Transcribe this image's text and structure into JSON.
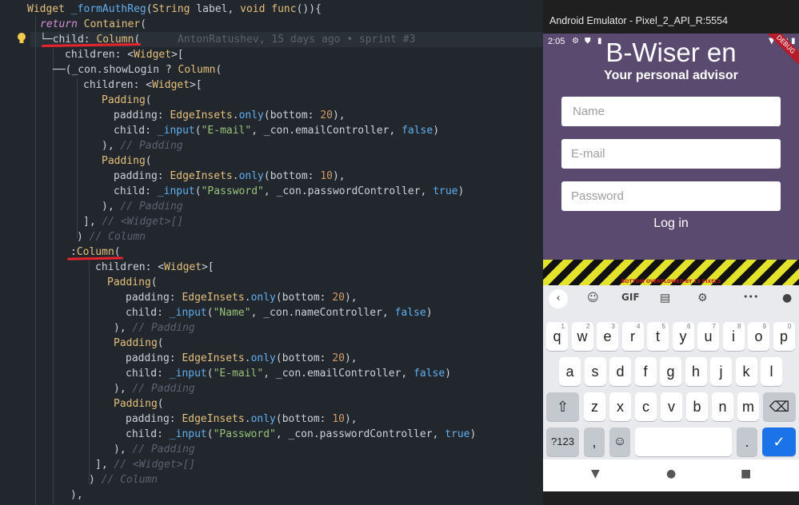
{
  "editor": {
    "blame": "AntonRatushev, 15 days ago • sprint #3",
    "lines": [
      {
        "indent": 34,
        "tokens": [
          [
            "ty",
            "Widget"
          ],
          [
            "pl",
            " "
          ],
          [
            "fn",
            "_formAuthReg"
          ],
          [
            "pl",
            "("
          ],
          [
            "ty",
            "String"
          ],
          [
            "pl",
            " label, "
          ],
          [
            "ty",
            "void"
          ],
          [
            "pl",
            " "
          ],
          [
            "ty",
            "func"
          ],
          [
            "pl",
            "()){"
          ]
        ]
      },
      {
        "indent": 50,
        "tokens": [
          [
            "kw",
            "return"
          ],
          [
            "pl",
            " "
          ],
          [
            "ty",
            "Container"
          ],
          [
            "pl",
            "("
          ]
        ]
      },
      {
        "indent": 50,
        "tokens": [
          [
            "pl",
            "└─child: "
          ],
          [
            "ty",
            "Column"
          ],
          [
            "pl",
            "("
          ]
        ]
      },
      {
        "indent": 81,
        "tokens": [
          [
            "pl",
            "children: <"
          ],
          [
            "ty",
            "Widget"
          ],
          [
            "pl",
            ">["
          ]
        ]
      },
      {
        "indent": 66,
        "tokens": [
          [
            "pl",
            "──(_con.showLogin ? "
          ],
          [
            "ty",
            "Column"
          ],
          [
            "pl",
            "("
          ]
        ]
      },
      {
        "indent": 104,
        "tokens": [
          [
            "pl",
            "children: <"
          ],
          [
            "ty",
            "Widget"
          ],
          [
            "pl",
            ">["
          ]
        ]
      },
      {
        "indent": 127,
        "tokens": [
          [
            "ty",
            "Padding"
          ],
          [
            "pl",
            "("
          ]
        ]
      },
      {
        "indent": 142,
        "tokens": [
          [
            "pl",
            "padding: "
          ],
          [
            "ty",
            "EdgeInsets"
          ],
          [
            "pl",
            "."
          ],
          [
            "fn",
            "only"
          ],
          [
            "pl",
            "(bottom: "
          ],
          [
            "nm",
            "20"
          ],
          [
            "pl",
            "),"
          ]
        ]
      },
      {
        "indent": 142,
        "tokens": [
          [
            "pl",
            "child: "
          ],
          [
            "fn",
            "_input"
          ],
          [
            "pl",
            "("
          ],
          [
            "st",
            "\"E-mail\""
          ],
          [
            "pl",
            ", _con.emailController, "
          ],
          [
            "bool",
            "false"
          ],
          [
            "pl",
            ")"
          ]
        ]
      },
      {
        "indent": 127,
        "tokens": [
          [
            "pl",
            "), "
          ],
          [
            "cm",
            "// Padding"
          ]
        ]
      },
      {
        "indent": 127,
        "tokens": [
          [
            "ty",
            "Padding"
          ],
          [
            "pl",
            "("
          ]
        ]
      },
      {
        "indent": 142,
        "tokens": [
          [
            "pl",
            "padding: "
          ],
          [
            "ty",
            "EdgeInsets"
          ],
          [
            "pl",
            "."
          ],
          [
            "fn",
            "only"
          ],
          [
            "pl",
            "(bottom: "
          ],
          [
            "nm",
            "10"
          ],
          [
            "pl",
            "),"
          ]
        ]
      },
      {
        "indent": 142,
        "tokens": [
          [
            "pl",
            "child: "
          ],
          [
            "fn",
            "_input"
          ],
          [
            "pl",
            "("
          ],
          [
            "st",
            "\"Password\""
          ],
          [
            "pl",
            ", _con.passwordController, "
          ],
          [
            "bool",
            "true"
          ],
          [
            "pl",
            ")"
          ]
        ]
      },
      {
        "indent": 127,
        "tokens": [
          [
            "pl",
            "), "
          ],
          [
            "cm",
            "// Padding"
          ]
        ]
      },
      {
        "indent": 104,
        "tokens": [
          [
            "pl",
            "], "
          ],
          [
            "cm",
            "// <Widget>[]"
          ]
        ]
      },
      {
        "indent": 96,
        "tokens": [
          [
            "pl",
            ") "
          ],
          [
            "cm",
            "// Column"
          ]
        ]
      },
      {
        "indent": 88,
        "tokens": [
          [
            "pl",
            ":"
          ],
          [
            "ty",
            "Column"
          ],
          [
            "pl",
            "("
          ]
        ]
      },
      {
        "indent": 119,
        "tokens": [
          [
            "pl",
            "children: <"
          ],
          [
            "ty",
            "Widget"
          ],
          [
            "pl",
            ">["
          ]
        ]
      },
      {
        "indent": 134,
        "tokens": [
          [
            "ty",
            "Padding"
          ],
          [
            "pl",
            "("
          ]
        ]
      },
      {
        "indent": 157,
        "tokens": [
          [
            "pl",
            "padding: "
          ],
          [
            "ty",
            "EdgeInsets"
          ],
          [
            "pl",
            "."
          ],
          [
            "fn",
            "only"
          ],
          [
            "pl",
            "(bottom: "
          ],
          [
            "nm",
            "20"
          ],
          [
            "pl",
            "),"
          ]
        ]
      },
      {
        "indent": 157,
        "tokens": [
          [
            "pl",
            "child: "
          ],
          [
            "fn",
            "_input"
          ],
          [
            "pl",
            "("
          ],
          [
            "st",
            "\"Name\""
          ],
          [
            "pl",
            ", _con.nameController, "
          ],
          [
            "bool",
            "false"
          ],
          [
            "pl",
            ")"
          ]
        ]
      },
      {
        "indent": 142,
        "tokens": [
          [
            "pl",
            "), "
          ],
          [
            "cm",
            "// Padding"
          ]
        ]
      },
      {
        "indent": 142,
        "tokens": [
          [
            "ty",
            "Padding"
          ],
          [
            "pl",
            "("
          ]
        ]
      },
      {
        "indent": 157,
        "tokens": [
          [
            "pl",
            "padding: "
          ],
          [
            "ty",
            "EdgeInsets"
          ],
          [
            "pl",
            "."
          ],
          [
            "fn",
            "only"
          ],
          [
            "pl",
            "(bottom: "
          ],
          [
            "nm",
            "20"
          ],
          [
            "pl",
            "),"
          ]
        ]
      },
      {
        "indent": 157,
        "tokens": [
          [
            "pl",
            "child: "
          ],
          [
            "fn",
            "_input"
          ],
          [
            "pl",
            "("
          ],
          [
            "st",
            "\"E-mail\""
          ],
          [
            "pl",
            ", _con.emailController, "
          ],
          [
            "bool",
            "false"
          ],
          [
            "pl",
            ")"
          ]
        ]
      },
      {
        "indent": 142,
        "tokens": [
          [
            "pl",
            "), "
          ],
          [
            "cm",
            "// Padding"
          ]
        ]
      },
      {
        "indent": 142,
        "tokens": [
          [
            "ty",
            "Padding"
          ],
          [
            "pl",
            "("
          ]
        ]
      },
      {
        "indent": 157,
        "tokens": [
          [
            "pl",
            "padding: "
          ],
          [
            "ty",
            "EdgeInsets"
          ],
          [
            "pl",
            "."
          ],
          [
            "fn",
            "only"
          ],
          [
            "pl",
            "(bottom: "
          ],
          [
            "nm",
            "10"
          ],
          [
            "pl",
            "),"
          ]
        ]
      },
      {
        "indent": 157,
        "tokens": [
          [
            "pl",
            "child: "
          ],
          [
            "fn",
            "_input"
          ],
          [
            "pl",
            "("
          ],
          [
            "st",
            "\"Password\""
          ],
          [
            "pl",
            ", _con.passwordController, "
          ],
          [
            "bool",
            "true"
          ],
          [
            "pl",
            ")"
          ]
        ]
      },
      {
        "indent": 142,
        "tokens": [
          [
            "pl",
            "), "
          ],
          [
            "cm",
            "// Padding"
          ]
        ]
      },
      {
        "indent": 119,
        "tokens": [
          [
            "pl",
            "], "
          ],
          [
            "cm",
            "// <Widget>[]"
          ]
        ]
      },
      {
        "indent": 111,
        "tokens": [
          [
            "pl",
            ") "
          ],
          [
            "cm",
            "// Column"
          ]
        ]
      },
      {
        "indent": 88,
        "tokens": [
          [
            "pl",
            "),"
          ]
        ]
      }
    ]
  },
  "emulator": {
    "window_title": "Android Emulator - Pixel_2_API_R:5554",
    "status_time": "2:05",
    "debug_banner": "DEBUG",
    "app": {
      "title": "B-Wiser en",
      "subtitle": "Your personal advisor",
      "name_placeholder": "Name",
      "email_placeholder": "E-mail",
      "password_placeholder": "Password",
      "login_label": "Log in",
      "overflow_text": "BOTTOM OVERFLOWED BY 15 PIXELS"
    },
    "keyboard": {
      "toolbar": {
        "gif": "GIF",
        "more": "•••"
      },
      "row1": [
        "q",
        "w",
        "e",
        "r",
        "t",
        "y",
        "u",
        "i",
        "o",
        "p"
      ],
      "row1_hints": [
        "1",
        "2",
        "3",
        "4",
        "5",
        "6",
        "7",
        "8",
        "9",
        "0"
      ],
      "row2": [
        "a",
        "s",
        "d",
        "f",
        "g",
        "h",
        "j",
        "k",
        "l"
      ],
      "row3": [
        "z",
        "x",
        "c",
        "v",
        "b",
        "n",
        "m"
      ],
      "symbols_label": "?123",
      "comma": ",",
      "period": "."
    },
    "colors": {
      "app_bg": "#5a4a70",
      "enter_key": "#1a73e8"
    }
  }
}
